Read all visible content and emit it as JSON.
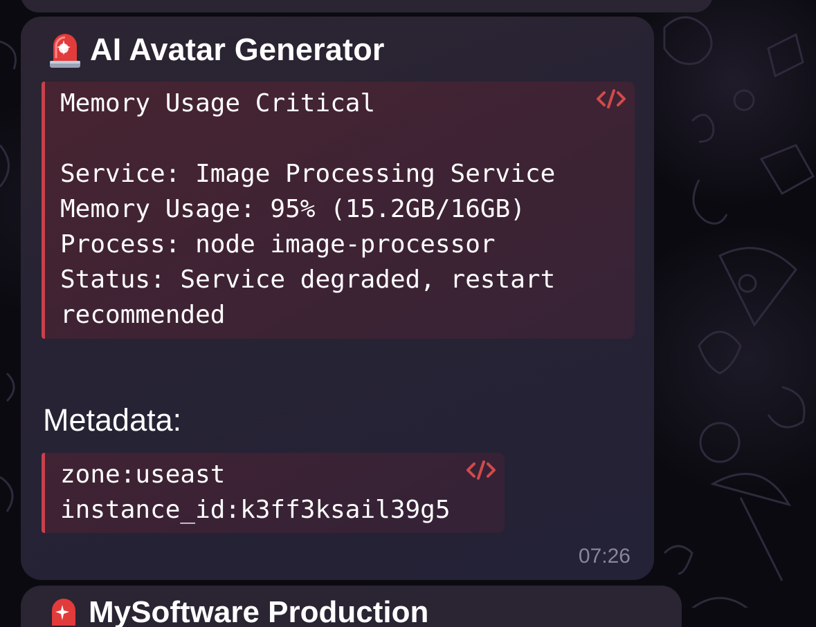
{
  "colors": {
    "bubble": "#2a2433",
    "accent_red": "#c8414b",
    "text": "#ffffff",
    "time_text": "#8a8699"
  },
  "message": {
    "icon": "siren-emoji-icon",
    "title": "AI Avatar Generator",
    "alert_block": {
      "icon": "code-icon",
      "lines": [
        "Memory Usage Critical",
        "",
        "Service: Image Processing Service",
        "Memory Usage: 95% (15.2GB/16GB)",
        "Process: node image-processor",
        "Status: Service degraded, restart",
        "recommended"
      ]
    },
    "metadata_label": "Metadata:",
    "metadata_block": {
      "icon": "code-icon",
      "lines": [
        "zone:useast",
        "instance_id:k3ff3ksail39g5"
      ]
    },
    "time": "07:26"
  },
  "next_message": {
    "icon": "siren-emoji-icon",
    "title_partial": "MySoftware Production"
  }
}
